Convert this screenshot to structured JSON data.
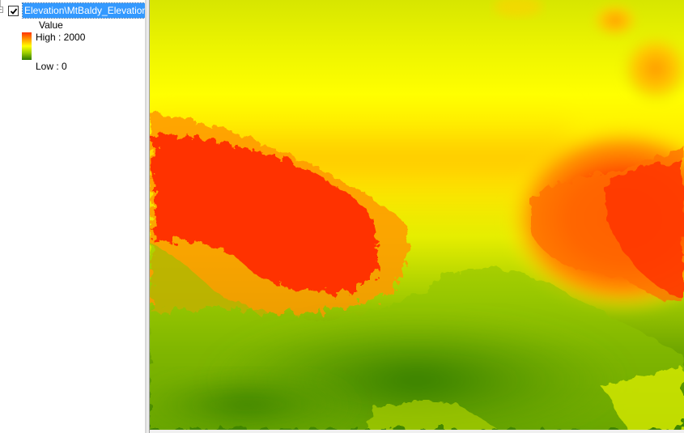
{
  "toc": {
    "layer_name": "Elevation\\MtBaldy_Elevation",
    "checked": true,
    "legend": {
      "field": "Value",
      "high_label": "High : 2000",
      "low_label": "Low : 0"
    }
  },
  "map": {
    "colors": {
      "high": "#ff3300",
      "mid_high": "#ff9900",
      "mid": "#ffff00",
      "mid_low": "#99cc00",
      "low": "#2e7a00"
    },
    "icons": [
      "checkbox-checked-icon",
      "expander-minus-icon"
    ]
  }
}
